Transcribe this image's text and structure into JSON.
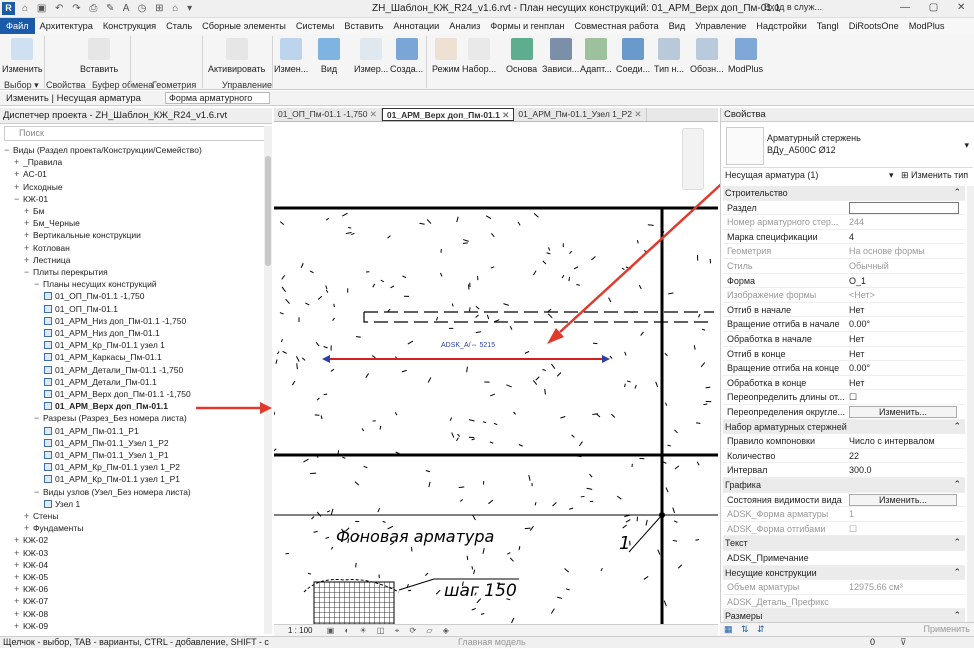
{
  "app": {
    "icon_letter": "R"
  },
  "window": {
    "title": "ZH_Шаблон_КЖ_R24_v1.6.rvt - План несущих конструкций: 01_АРМ_Верх доп_Пм-01.1",
    "search_label": "Вход в служ..."
  },
  "menu": [
    "Файл",
    "Архитектура",
    "Конструкция",
    "Сталь",
    "Сборные элементы",
    "Системы",
    "Вставить",
    "Аннотации",
    "Анализ",
    "Формы и генплан",
    "Совместная работа",
    "Вид",
    "Управление",
    "Надстройки",
    "Tangl",
    "DiRootsOne",
    "ModPlus"
  ],
  "ribbon": {
    "buttons": [
      {
        "label": "Изменить"
      },
      {
        "label": "Вставить"
      },
      {
        "label": "Активировать"
      },
      {
        "label": "Измен..."
      },
      {
        "label": "Вид"
      },
      {
        "label": "Измер..."
      },
      {
        "label": "Созда..."
      },
      {
        "label": "Режим"
      },
      {
        "label": "Набор..."
      },
      {
        "label": "Основа"
      },
      {
        "label": "Зависи..."
      },
      {
        "label": "Адапт..."
      },
      {
        "label": "Соеди..."
      },
      {
        "label": "Тип н..."
      },
      {
        "label": "Обозн..."
      },
      {
        "label": "ModPlus"
      }
    ],
    "groups": [
      "Выбор ▾",
      "Свойства",
      "Буфер обмена",
      "Геометрия",
      "Управление"
    ]
  },
  "options_bar": {
    "context": "Изменить | Несущая арматура",
    "dropdown": "Форма арматурного"
  },
  "project_browser": {
    "title": "Диспетчер проекта - ZH_Шаблон_КЖ_R24_v1.6.rvt",
    "search_placeholder": "Поиск",
    "nodes": [
      {
        "t": "Виды (Раздел проекта/Конструкции/Семейство)",
        "lvl": 0,
        "tg": "−"
      },
      {
        "t": "_Правила",
        "lvl": 1,
        "tg": "+"
      },
      {
        "t": "АС-01",
        "lvl": 1,
        "tg": "+"
      },
      {
        "t": "Исходные",
        "lvl": 1,
        "tg": "+"
      },
      {
        "t": "КЖ-01",
        "lvl": 1,
        "tg": "−"
      },
      {
        "t": "Бм",
        "lvl": 2,
        "tg": "+"
      },
      {
        "t": "Бм_Черные",
        "lvl": 2,
        "tg": "+"
      },
      {
        "t": "Вертикальные конструкции",
        "lvl": 2,
        "tg": "+"
      },
      {
        "t": "Котлован",
        "lvl": 2,
        "tg": "+"
      },
      {
        "t": "Лестница",
        "lvl": 2,
        "tg": "+"
      },
      {
        "t": "Плиты перекрытия",
        "lvl": 2,
        "tg": "−"
      },
      {
        "t": "Планы несущих конструкций",
        "lvl": 3,
        "tg": "−"
      },
      {
        "t": "01_ОП_Пм-01.1 -1,750",
        "lvl": 4,
        "v": 1
      },
      {
        "t": "01_ОП_Пм-01.1",
        "lvl": 4,
        "v": 1
      },
      {
        "t": "01_АРМ_Низ доп_Пм-01.1 -1,750",
        "lvl": 4,
        "v": 1
      },
      {
        "t": "01_АРМ_Низ доп_Пм-01.1",
        "lvl": 4,
        "v": 1
      },
      {
        "t": "01_АРМ_Кр_Пм-01.1 узел 1",
        "lvl": 4,
        "v": 1
      },
      {
        "t": "01_АРМ_Каркасы_Пм-01.1",
        "lvl": 4,
        "v": 1
      },
      {
        "t": "01_АРМ_Детали_Пм-01.1 -1,750",
        "lvl": 4,
        "v": 1
      },
      {
        "t": "01_АРМ_Детали_Пм-01.1",
        "lvl": 4,
        "v": 1
      },
      {
        "t": "01_АРМ_Верх доп_Пм-01.1 -1,750",
        "lvl": 4,
        "v": 1
      },
      {
        "t": "01_АРМ_Верх доп_Пм-01.1",
        "lvl": 4,
        "v": 1,
        "bold": 1
      },
      {
        "t": "Разрезы (Разрез_Без номера листа)",
        "lvl": 3,
        "tg": "−"
      },
      {
        "t": "01_АРМ_Пм-01.1_Р1",
        "lvl": 4,
        "v": 1
      },
      {
        "t": "01_АРМ_Пм-01.1_Узел 1_Р2",
        "lvl": 4,
        "v": 1
      },
      {
        "t": "01_АРМ_Пм-01.1_Узел 1_Р1",
        "lvl": 4,
        "v": 1
      },
      {
        "t": "01_АРМ_Кр_Пм-01.1 узел 1_Р2",
        "lvl": 4,
        "v": 1
      },
      {
        "t": "01_АРМ_Кр_Пм-01.1 узел 1_Р1",
        "lvl": 4,
        "v": 1
      },
      {
        "t": "Виды узлов (Узел_Без номера листа)",
        "lvl": 3,
        "tg": "−"
      },
      {
        "t": "Узел 1",
        "lvl": 4,
        "v": 1
      },
      {
        "t": "Стены",
        "lvl": 2,
        "tg": "+"
      },
      {
        "t": "Фундаменты",
        "lvl": 2,
        "tg": "+"
      },
      {
        "t": "КЖ-02",
        "lvl": 1,
        "tg": "+"
      },
      {
        "t": "КЖ-03",
        "lvl": 1,
        "tg": "+"
      },
      {
        "t": "КЖ-04",
        "lvl": 1,
        "tg": "+"
      },
      {
        "t": "КЖ-05",
        "lvl": 1,
        "tg": "+"
      },
      {
        "t": "КЖ-06",
        "lvl": 1,
        "tg": "+"
      },
      {
        "t": "КЖ-07",
        "lvl": 1,
        "tg": "+"
      },
      {
        "t": "КЖ-08",
        "lvl": 1,
        "tg": "+"
      },
      {
        "t": "КЖ-09",
        "lvl": 1,
        "tg": "+"
      }
    ]
  },
  "doc_tabs": [
    {
      "label": "01_ОП_Пм-01.1 -1,750",
      "active": false
    },
    {
      "label": "01_АРМ_Верх доп_Пм-01.1",
      "active": true
    },
    {
      "label": "01_АРМ_Пм-01.1_Узел 1_Р2",
      "active": false
    }
  ],
  "canvas": {
    "rebar_tag": "ADSK_А/⇔ 5215",
    "note_text": "Фоновая арматура",
    "step_text": "шаг 150",
    "marker": "1",
    "scale": "1 : 100"
  },
  "properties": {
    "title": "Свойства",
    "type_name": "Арматурный стержень",
    "type_sub": "ВДу_А500С Ø12",
    "instance_selector": "Несущая арматура (1)",
    "edit_type": "Изменить тип",
    "rows": [
      {
        "k": "Строительство",
        "sect": 1
      },
      {
        "k": "Раздел",
        "input": 1
      },
      {
        "k": "Номер арматурного стер...",
        "v": "244",
        "dim": 1
      },
      {
        "k": "Марка спецификации",
        "v": "4"
      },
      {
        "k": "Геометрия",
        "v": "На основе формы",
        "dim": 1
      },
      {
        "k": "Стиль",
        "v": "Обычный",
        "dim": 1
      },
      {
        "k": "Форма",
        "v": "О_1"
      },
      {
        "k": "Изображение формы",
        "v": "<Нет>",
        "dim": 1
      },
      {
        "k": "Отгиб в начале",
        "v": "Нет"
      },
      {
        "k": "Вращение отгиба в начале",
        "v": "0.00°"
      },
      {
        "k": "Обработка в начале",
        "v": "Нет"
      },
      {
        "k": "Отгиб в конце",
        "v": "Нет"
      },
      {
        "k": "Вращение отгиба на конце",
        "v": "0.00°"
      },
      {
        "k": "Обработка в конце",
        "v": "Нет"
      },
      {
        "k": "Переопределить длины от...",
        "v": "☐"
      },
      {
        "k": "Переопределения округле...",
        "btn": "Изменить..."
      },
      {
        "k": "Набор арматурных стержней",
        "sect": 1
      },
      {
        "k": "Правило компоновки",
        "v": "Число с интервалом"
      },
      {
        "k": "Количество",
        "v": "22"
      },
      {
        "k": "Интервал",
        "v": "300.0"
      },
      {
        "k": "Графика",
        "sect": 1
      },
      {
        "k": "Состояния видимости вида",
        "btn": "Изменить..."
      },
      {
        "k": "ADSK_Форма арматуры",
        "v": "1",
        "dim": 1
      },
      {
        "k": "ADSK_Форма отгибами",
        "v": "☐",
        "dim": 1
      },
      {
        "k": "Текст",
        "sect": 1
      },
      {
        "k": "ADSK_Примечание",
        "v": ""
      },
      {
        "k": "Несущие конструкции",
        "sect": 1
      },
      {
        "k": "Объем арматуры",
        "v": "12975.66 см³",
        "dim": 1
      },
      {
        "k": "ADSK_Деталь_Префикс",
        "v": "",
        "dim": 1
      },
      {
        "k": "Размеры",
        "sect": 1
      }
    ],
    "apply": "Применить"
  },
  "statusbar": {
    "hint": "Щелчок - выбор, TAB - варианты, CTRL - добавление, SHIFT - с",
    "model": "Главная модель",
    "sel_count": "0"
  },
  "colors": {
    "accent": "#1a5aa6",
    "annotation_red": "#e03a2e",
    "rebar_red": "#d61f1f",
    "rebar_blue": "#2c3fa6"
  }
}
